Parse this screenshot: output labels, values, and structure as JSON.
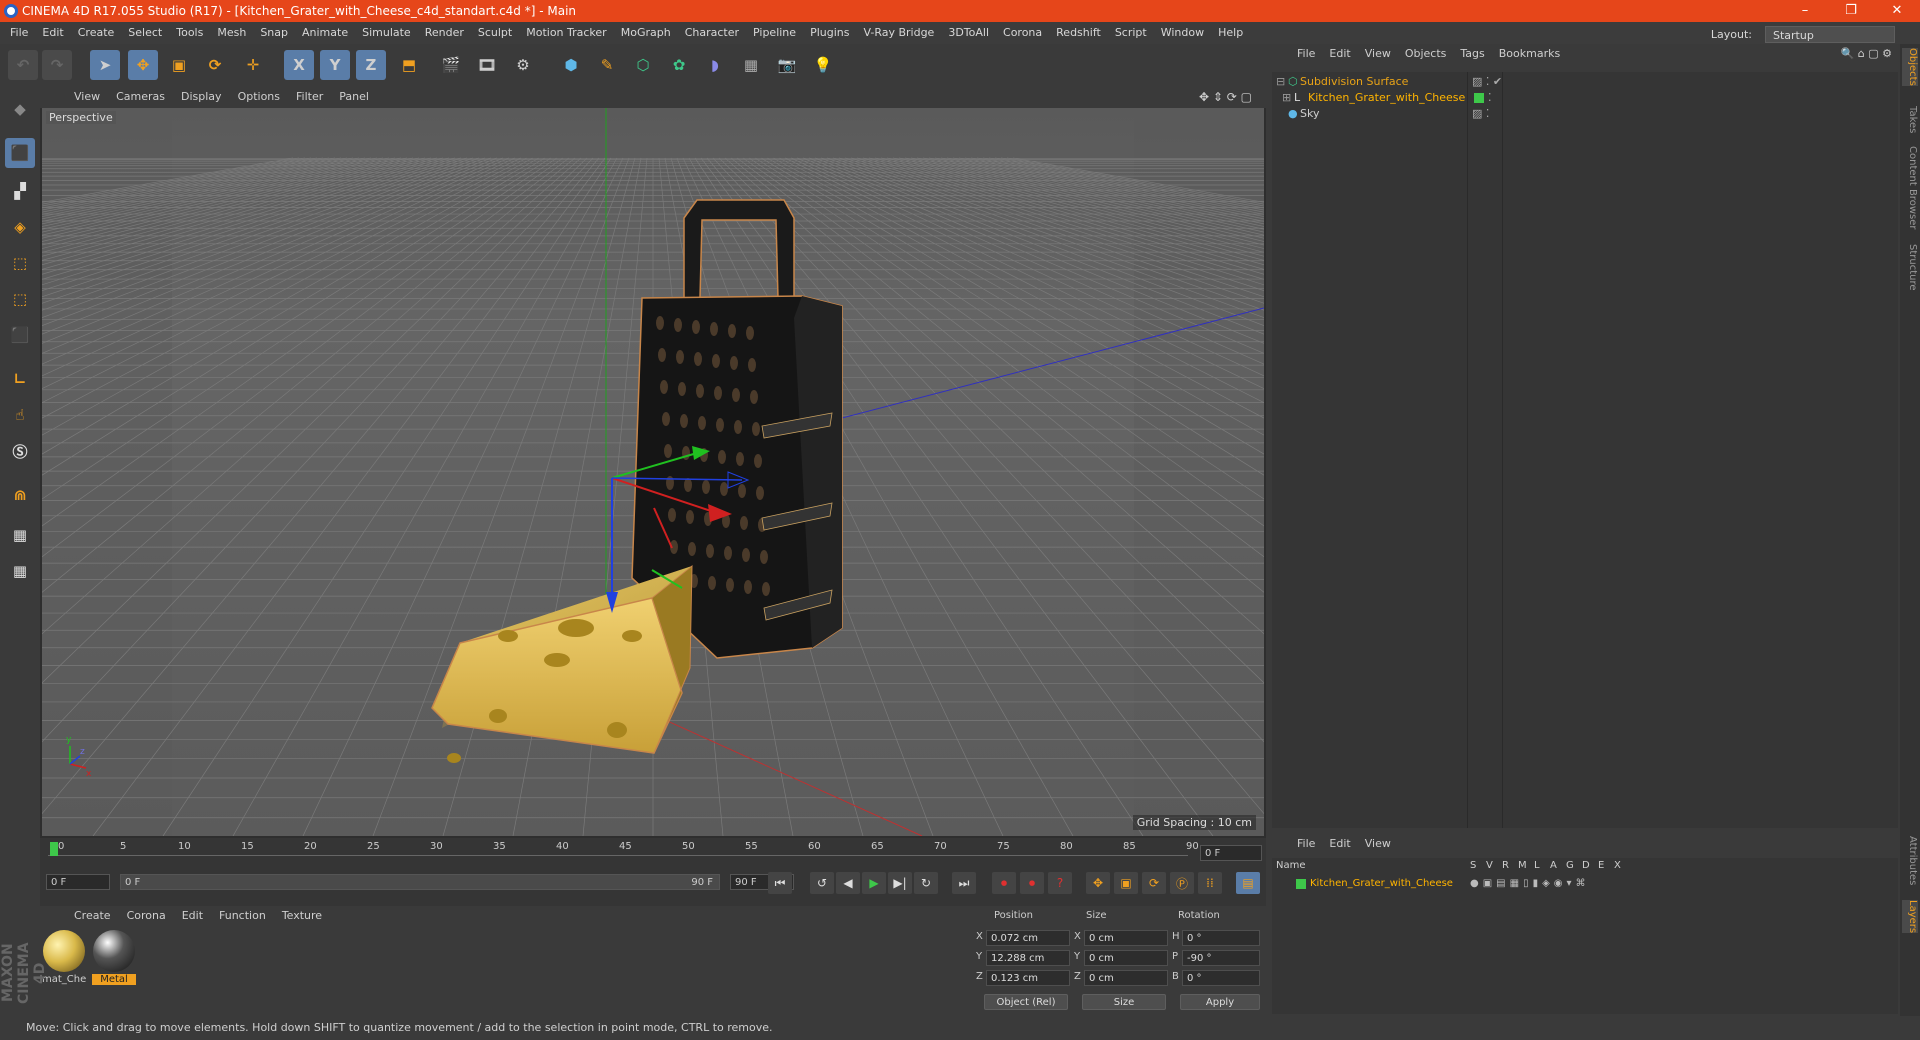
{
  "window": {
    "title": "CINEMA 4D R17.055 Studio (R17) - [Kitchen_Grater_with_Cheese_c4d_standart.c4d *] - Main",
    "controls": [
      "–",
      "❐",
      "✕"
    ]
  },
  "menubar": {
    "items": [
      "File",
      "Edit",
      "Create",
      "Select",
      "Tools",
      "Mesh",
      "Snap",
      "Animate",
      "Simulate",
      "Render",
      "Sculpt",
      "Motion Tracker",
      "MoGraph",
      "Character",
      "Pipeline",
      "Plugins",
      "V-Ray Bridge",
      "3DToAll",
      "Corona",
      "Redshift",
      "Script",
      "Window",
      "Help"
    ],
    "layout_label": "Layout:",
    "layout_value": "Startup"
  },
  "toolbar": {
    "axis_x": "X",
    "axis_y": "Y",
    "axis_z": "Z"
  },
  "viewport": {
    "menu": [
      "View",
      "Cameras",
      "Display",
      "Options",
      "Filter",
      "Panel"
    ],
    "label": "Perspective",
    "grid_spacing": "Grid Spacing : 10 cm",
    "axis_y": "y",
    "axis_z": "z",
    "axis_x": "x"
  },
  "timeline": {
    "ticks": [
      "0",
      "5",
      "10",
      "15",
      "20",
      "25",
      "30",
      "35",
      "40",
      "45",
      "50",
      "55",
      "60",
      "65",
      "70",
      "75",
      "80",
      "85",
      "90"
    ],
    "current_frame": "0 F",
    "start_frame": "0 F",
    "range_start": "0 F",
    "range_end": "90 F",
    "end_frame": "90 F"
  },
  "materials": {
    "menu": [
      "Create",
      "Corona",
      "Edit",
      "Function",
      "Texture"
    ],
    "items": [
      {
        "name": "mat_Che",
        "color": "#d9b94a"
      },
      {
        "name": "Metal",
        "color": "#555555"
      }
    ]
  },
  "coordinates": {
    "headers": [
      "Position",
      "Size",
      "Rotation"
    ],
    "rows": [
      {
        "axis": "X",
        "pos": "0.072 cm",
        "size_axis": "X",
        "size": "0 cm",
        "rot_axis": "H",
        "rot": "0 °"
      },
      {
        "axis": "Y",
        "pos": "12.288 cm",
        "size_axis": "Y",
        "size": "0 cm",
        "rot_axis": "P",
        "rot": "-90 °"
      },
      {
        "axis": "Z",
        "pos": "0.123 cm",
        "size_axis": "Z",
        "size": "0 cm",
        "rot_axis": "B",
        "rot": "0 °"
      }
    ],
    "mode_select": "Object (Rel)",
    "size_select": "Size",
    "apply_label": "Apply"
  },
  "object_manager": {
    "menu": [
      "File",
      "Edit",
      "View",
      "Objects",
      "Tags",
      "Bookmarks"
    ],
    "objects": [
      {
        "name": "Subdivision Surface",
        "color": "#e8a317"
      },
      {
        "name": "Kitchen_Grater_with_Cheese",
        "color": "#ffb400"
      },
      {
        "name": "Sky",
        "color": "#cfcfcf"
      }
    ]
  },
  "layers": {
    "menu": [
      "File",
      "Edit",
      "View"
    ],
    "col_name": "Name",
    "col_flags": [
      "S",
      "V",
      "R",
      "M",
      "L",
      "A",
      "G",
      "D",
      "E",
      "X"
    ],
    "rows": [
      {
        "name": "Kitchen_Grater_with_Cheese",
        "color": "#ffb400"
      }
    ]
  },
  "side_tabs": [
    "Objects",
    "Takes",
    "Content Browser",
    "Structure"
  ],
  "side_tabs_bottom": [
    "Attributes",
    "Layers"
  ],
  "status": "Move: Click and drag to move elements. Hold down SHIFT to quantize movement / add to the selection in point mode, CTRL to remove.",
  "brand": "MAXON CINEMA 4D",
  "accent": "#e6461a"
}
